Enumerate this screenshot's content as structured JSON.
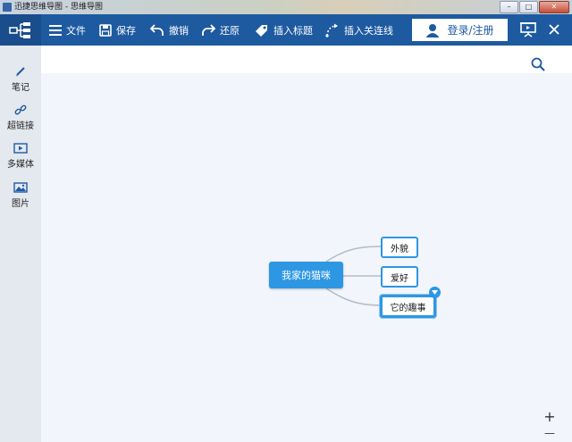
{
  "window": {
    "title": "迅捷思维导图 - 思维导图",
    "minimize": "–",
    "maximize": "□",
    "close": "✕"
  },
  "toolbar": {
    "file_label": "文件",
    "save_label": "保存",
    "undo_label": "撤销",
    "redo_label": "还原",
    "insert_title_label": "插入标题",
    "insert_connector_label": "插入关连线",
    "login_label": "登录/注册",
    "close_label": "✕"
  },
  "sidebar": {
    "items": [
      {
        "label": "笔记",
        "icon": "pencil-icon"
      },
      {
        "label": "超链接",
        "icon": "link-icon"
      },
      {
        "label": "多媒体",
        "icon": "media-icon"
      },
      {
        "label": "图片",
        "icon": "image-icon"
      }
    ]
  },
  "mindmap": {
    "root": "我家的猫咪",
    "children": [
      "外貌",
      "爱好",
      "它的趣事"
    ]
  },
  "zoom": {
    "in_label": "+",
    "out_label": "—"
  },
  "colors": {
    "toolbar": "#1e5aa0",
    "accent": "#2d97e4",
    "canvas": "#f2f5fb",
    "sidebar": "#e4e8ef"
  }
}
